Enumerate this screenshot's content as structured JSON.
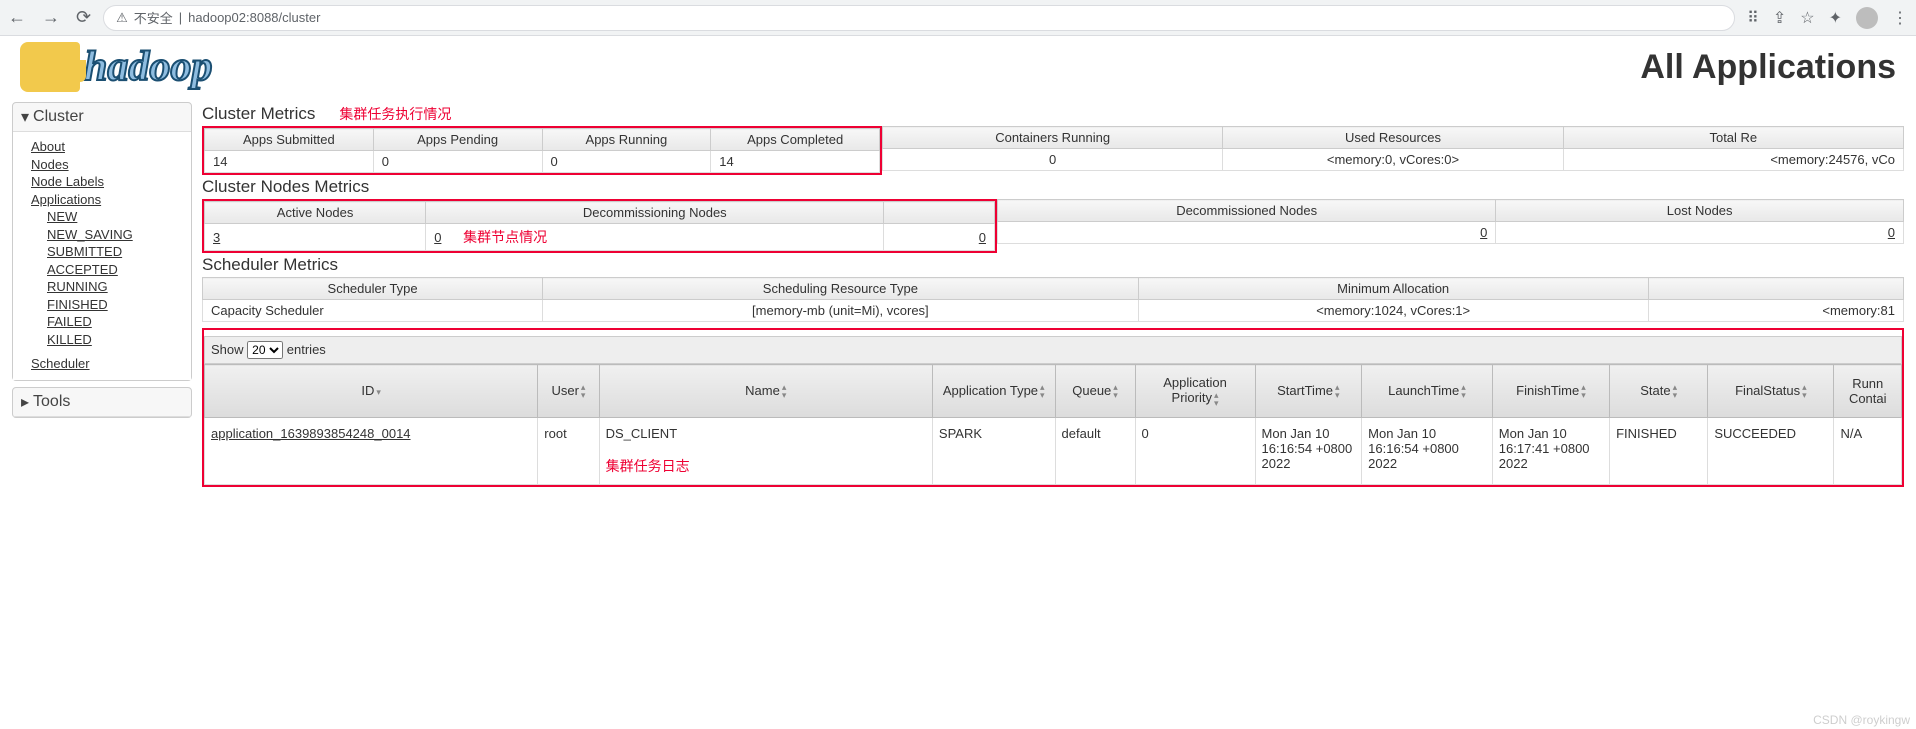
{
  "browser": {
    "insecure_label": "不安全",
    "url": "hadoop02:8088/cluster"
  },
  "header": {
    "logo_text": "hadoop",
    "page_title": "All Applications"
  },
  "sidebar": {
    "cluster_label": "Cluster",
    "about": "About",
    "nodes": "Nodes",
    "node_labels": "Node Labels",
    "applications": "Applications",
    "states": {
      "new": "NEW",
      "new_saving": "NEW_SAVING",
      "submitted": "SUBMITTED",
      "accepted": "ACCEPTED",
      "running": "RUNNING",
      "finished": "FINISHED",
      "failed": "FAILED",
      "killed": "KILLED"
    },
    "scheduler": "Scheduler",
    "tools_label": "Tools"
  },
  "annotations": {
    "cluster_metrics_note": "集群任务执行情况",
    "nodes_note": "集群节点情况",
    "apps_note": "集群任务日志"
  },
  "cluster_metrics": {
    "title": "Cluster Metrics",
    "headers": {
      "apps_submitted": "Apps Submitted",
      "apps_pending": "Apps Pending",
      "apps_running": "Apps Running",
      "apps_completed": "Apps Completed",
      "containers_running": "Containers Running",
      "used_resources": "Used Resources",
      "total_resources": "Total Re"
    },
    "values": {
      "apps_submitted": "14",
      "apps_pending": "0",
      "apps_running": "0",
      "apps_completed": "14",
      "containers_running": "0",
      "used_resources": "<memory:0, vCores:0>",
      "total_resources": "<memory:24576, vCo"
    }
  },
  "nodes_metrics": {
    "title": "Cluster Nodes Metrics",
    "headers": {
      "active": "Active Nodes",
      "decommissioning": "Decommissioning Nodes",
      "decommissioned": "Decommissioned Nodes",
      "lost": "Lost Nodes"
    },
    "values": {
      "active": "3",
      "decommissioning": "0",
      "decommissioning2": "0",
      "decommissioned": "0",
      "lost": "0"
    }
  },
  "scheduler_metrics": {
    "title": "Scheduler Metrics",
    "headers": {
      "type": "Scheduler Type",
      "resource_type": "Scheduling Resource Type",
      "min_alloc": "Minimum Allocation"
    },
    "values": {
      "type": "Capacity Scheduler",
      "resource_type": "[memory-mb (unit=Mi), vcores]",
      "min_alloc": "<memory:1024, vCores:1>",
      "max_alloc": "<memory:81"
    }
  },
  "apps_table": {
    "show_label": "Show",
    "entries_label": "entries",
    "selected_count": "20",
    "headers": {
      "id": "ID",
      "user": "User",
      "name": "Name",
      "app_type": "Application Type",
      "queue": "Queue",
      "priority": "Application Priority",
      "start": "StartTime",
      "launch": "LaunchTime",
      "finish": "FinishTime",
      "state": "State",
      "final_status": "FinalStatus",
      "running_containers": "Runn Contai"
    },
    "rows": [
      {
        "id": "application_1639893854248_0014",
        "user": "root",
        "name": "DS_CLIENT",
        "app_type": "SPARK",
        "queue": "default",
        "priority": "0",
        "start": "Mon Jan 10 16:16:54 +0800 2022",
        "launch": "Mon Jan 10 16:16:54 +0800 2022",
        "finish": "Mon Jan 10 16:17:41 +0800 2022",
        "state": "FINISHED",
        "final_status": "SUCCEEDED",
        "running_containers": "N/A"
      }
    ]
  },
  "watermark": "CSDN @roykingw"
}
